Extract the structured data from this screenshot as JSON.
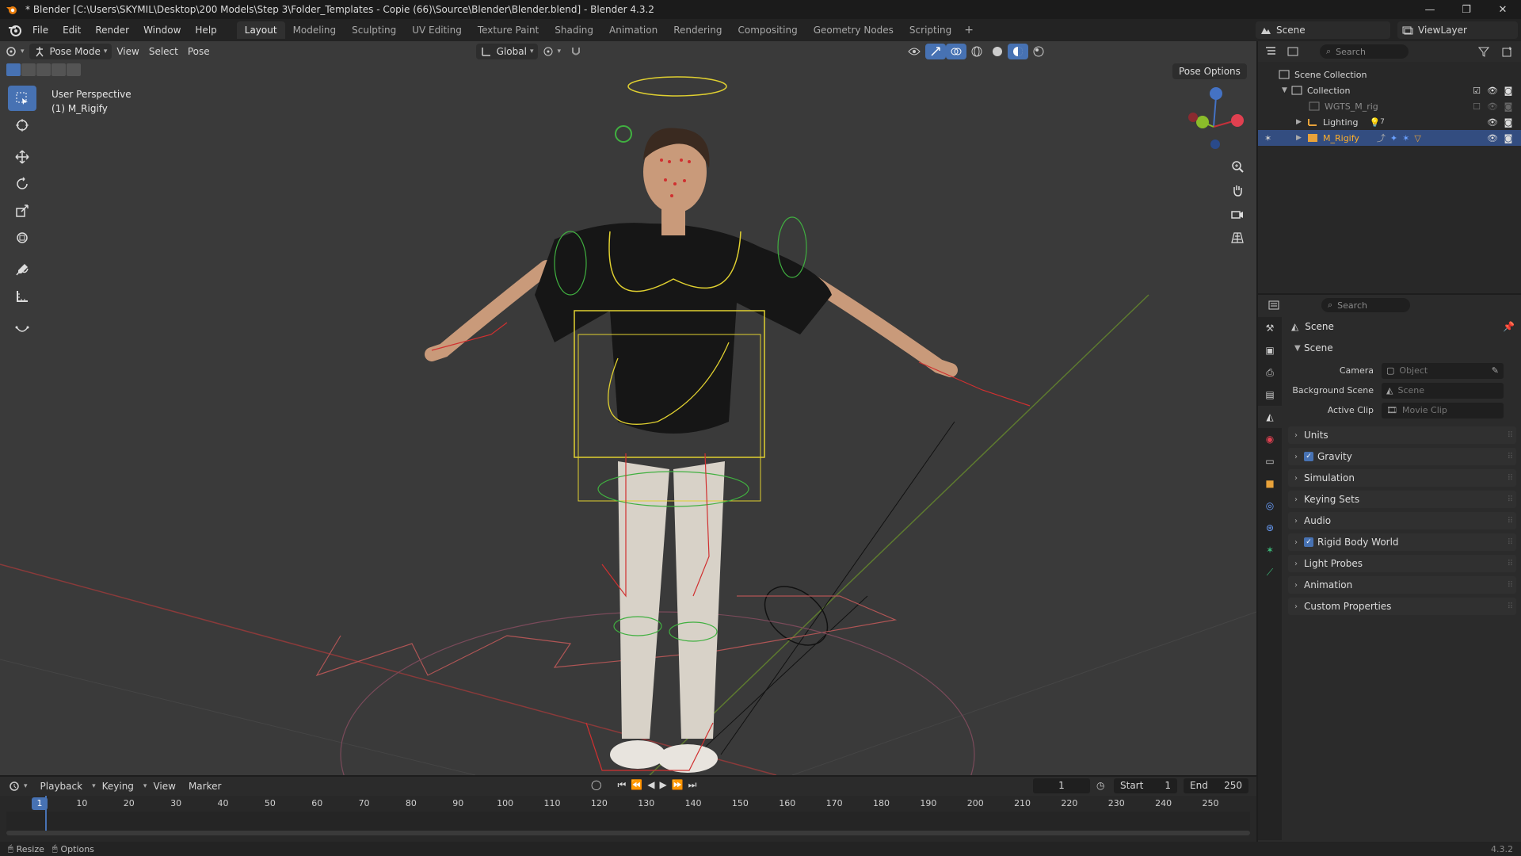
{
  "window": {
    "title": "* Blender [C:\\Users\\SKYMIL\\Desktop\\200 Models\\Step 3\\Folder_Templates - Copie (66)\\Source\\Blender\\Blender.blend] - Blender 4.3.2",
    "controls": [
      "—",
      "❐",
      "✕"
    ]
  },
  "menu": [
    "File",
    "Edit",
    "Render",
    "Window",
    "Help"
  ],
  "workspaces": [
    "Layout",
    "Modeling",
    "Sculpting",
    "UV Editing",
    "Texture Paint",
    "Shading",
    "Animation",
    "Rendering",
    "Compositing",
    "Geometry Nodes",
    "Scripting"
  ],
  "workspace_active": "Layout",
  "scene_name": "Scene",
  "view_layer": "ViewLayer",
  "viewport": {
    "mode": "Pose Mode",
    "menus": [
      "View",
      "Select",
      "Pose"
    ],
    "orientation": "Global",
    "info_line1": "User Perspective",
    "info_line2": "(1) M_Rigify",
    "pose_options": "Pose Options"
  },
  "outliner": {
    "search_placeholder": "Search",
    "rows": [
      {
        "label": "Scene Collection"
      },
      {
        "label": "Collection"
      },
      {
        "label": "WGTS_M_rig"
      },
      {
        "label": "Lighting"
      },
      {
        "label": "M_Rigify"
      }
    ],
    "lighting_count": "7"
  },
  "properties": {
    "search_placeholder": "Search",
    "context": "Scene",
    "section": "Scene",
    "fields": [
      {
        "label": "Camera",
        "placeholder": "Object"
      },
      {
        "label": "Background Scene",
        "placeholder": "Scene"
      },
      {
        "label": "Active Clip",
        "placeholder": "Movie Clip"
      }
    ],
    "panels": [
      "Units",
      "Gravity",
      "Simulation",
      "Keying Sets",
      "Audio",
      "Rigid Body World",
      "Light Probes",
      "Animation",
      "Custom Properties"
    ],
    "checked_panels": [
      "Gravity",
      "Rigid Body World"
    ]
  },
  "timeline": {
    "menus": [
      "Playback",
      "Keying",
      "View",
      "Marker"
    ],
    "current_frame": "1",
    "start_label": "Start",
    "start": "1",
    "end_label": "End",
    "end": "250",
    "ticks": [
      "10",
      "20",
      "30",
      "40",
      "50",
      "60",
      "70",
      "80",
      "90",
      "100",
      "110",
      "120",
      "130",
      "140",
      "150",
      "160",
      "170",
      "180",
      "190",
      "200",
      "210",
      "220",
      "230",
      "240",
      "250"
    ]
  },
  "status": {
    "left1": "Resize",
    "left2": "Options",
    "version": "4.3.2"
  },
  "colors": {
    "accent": "#4772b3",
    "selected": "#ffaf29",
    "bone_yellow": "#e0d030",
    "bone_red": "#d03030",
    "bone_green": "#40b040"
  }
}
